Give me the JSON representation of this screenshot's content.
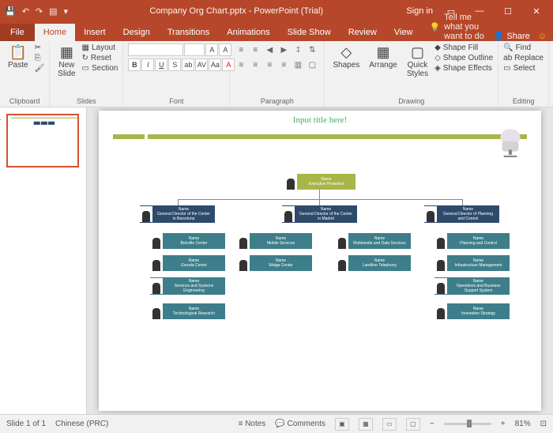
{
  "titlebar": {
    "filename": "Company Org Chart.pptx  -  PowerPoint (Trial)",
    "signin": "Sign in"
  },
  "tabs": {
    "file": "File",
    "home": "Home",
    "insert": "Insert",
    "design": "Design",
    "transitions": "Transitions",
    "animations": "Animations",
    "slideshow": "Slide Show",
    "review": "Review",
    "view": "View",
    "tellme": "Tell me what you want to do",
    "share": "Share"
  },
  "ribbon": {
    "clipboard": {
      "label": "Clipboard",
      "paste": "Paste"
    },
    "slides": {
      "label": "Slides",
      "new": "New\nSlide",
      "layout": "Layout",
      "reset": "Reset",
      "section": "Section"
    },
    "font": {
      "label": "Font"
    },
    "paragraph": {
      "label": "Paragraph"
    },
    "drawing": {
      "label": "Drawing",
      "shapes": "Shapes",
      "arrange": "Arrange",
      "quick": "Quick\nStyles",
      "fill": "Shape Fill",
      "outline": "Shape Outline",
      "effects": "Shape Effects"
    },
    "editing": {
      "label": "Editing",
      "find": "Find",
      "replace": "Replace",
      "select": "Select"
    }
  },
  "slide": {
    "title": "Input title here!",
    "president": {
      "name": "Name",
      "role": "Executive President"
    },
    "dirs": [
      {
        "name": "Name",
        "role": "General Director of the Center in Barcelona"
      },
      {
        "name": "Name",
        "role": "General Director of the Center in Madrid"
      },
      {
        "name": "Name",
        "role": "General Director of Planning and Control"
      }
    ],
    "col1": [
      {
        "name": "Name",
        "role": "Bonville Center"
      },
      {
        "name": "Name",
        "role": "Garuda Center"
      },
      {
        "name": "Name",
        "role": "Services and Systems Engineering"
      },
      {
        "name": "Name",
        "role": "Technological Research"
      }
    ],
    "col2": [
      {
        "name": "Name",
        "role": "Mobile Services"
      },
      {
        "name": "Name",
        "role": "Walga Center"
      }
    ],
    "col3": [
      {
        "name": "Name",
        "role": "Multimedia and Data Services"
      },
      {
        "name": "Name",
        "role": "Landline Telephony"
      }
    ],
    "col4": [
      {
        "name": "Name",
        "role": "Planning and Control"
      },
      {
        "name": "Name",
        "role": "Infrastructure Management"
      },
      {
        "name": "Name",
        "role": "Operations and Business Support System"
      },
      {
        "name": "Name",
        "role": "Innovation Strategy"
      }
    ]
  },
  "status": {
    "slide": "Slide 1 of 1",
    "lang": "Chinese (PRC)",
    "notes": "Notes",
    "comments": "Comments",
    "zoom": "81%"
  },
  "thumb_num": "1"
}
